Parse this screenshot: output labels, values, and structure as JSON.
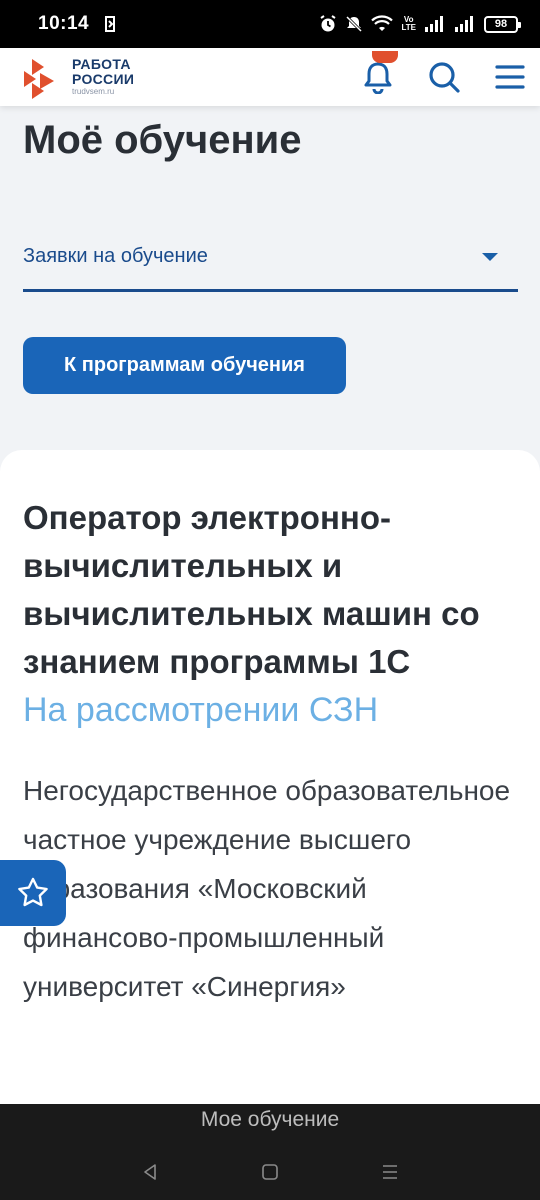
{
  "status_bar": {
    "time": "10:14",
    "volte_top": "Vo",
    "volte_bottom": "LTE",
    "battery": "98"
  },
  "header": {
    "logo_line1": "РАБОТА",
    "logo_line2": "РОССИИ",
    "logo_sub": "trudvsem.ru",
    "brand_color": "#e0502e"
  },
  "main": {
    "title": "Моё обучение",
    "select_value": "Заявки на обучение",
    "programs_button": "К программам обучения"
  },
  "card": {
    "title": "Оператор электронно-вычислительных и вычислительных машин со знанием программы 1С",
    "status": "На рассмотрении СЗН",
    "organization": "Негосударственное образовательное частное учреждение высшего образования «Московский финансово-промышленный университет «Синергия»"
  },
  "bottom": {
    "page_label": "Мое обучение"
  }
}
